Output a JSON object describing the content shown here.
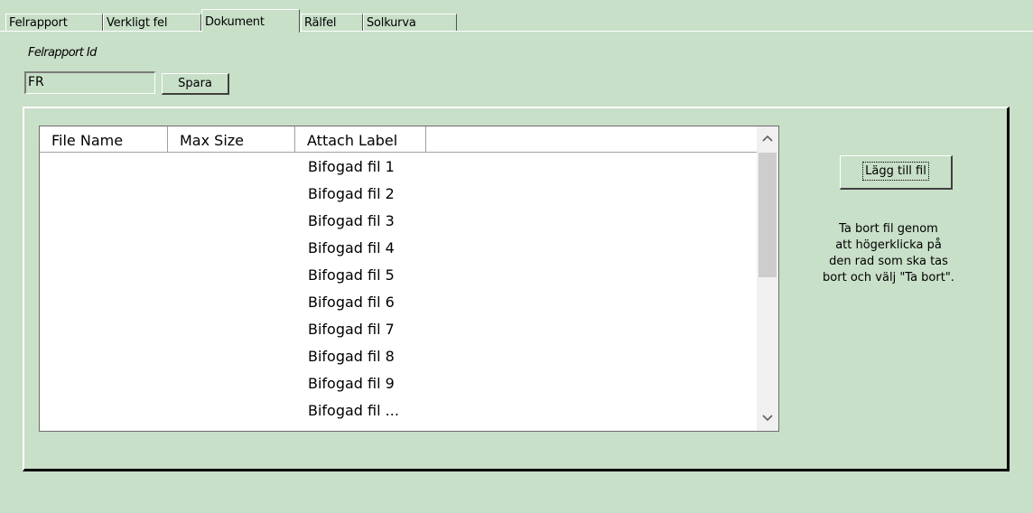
{
  "tabs": [
    {
      "label": "Felrapport",
      "active": false
    },
    {
      "label": "Verkligt fel",
      "active": false
    },
    {
      "label": "Dokument",
      "active": true
    },
    {
      "label": "Rälfel",
      "active": false
    },
    {
      "label": "Solkurva",
      "active": false
    }
  ],
  "felrapport": {
    "label": "Felrapport Id",
    "value": "FR",
    "save_label": "Spara"
  },
  "list": {
    "columns": [
      "File Name",
      "Max Size",
      "Attach Label"
    ],
    "rows": [
      {
        "file_name": "",
        "max_size": "",
        "attach_label": "Bifogad fil 1"
      },
      {
        "file_name": "",
        "max_size": "",
        "attach_label": "Bifogad fil 2"
      },
      {
        "file_name": "",
        "max_size": "",
        "attach_label": "Bifogad fil 3"
      },
      {
        "file_name": "",
        "max_size": "",
        "attach_label": "Bifogad fil 4"
      },
      {
        "file_name": "",
        "max_size": "",
        "attach_label": "Bifogad fil 5"
      },
      {
        "file_name": "",
        "max_size": "",
        "attach_label": "Bifogad fil 6"
      },
      {
        "file_name": "",
        "max_size": "",
        "attach_label": "Bifogad fil 7"
      },
      {
        "file_name": "",
        "max_size": "",
        "attach_label": "Bifogad fil 8"
      },
      {
        "file_name": "",
        "max_size": "",
        "attach_label": "Bifogad fil 9"
      },
      {
        "file_name": "",
        "max_size": "",
        "attach_label": "Bifogad fil ..."
      }
    ],
    "scroll_up_icon": "chevron-up-icon",
    "scroll_down_icon": "chevron-down-icon"
  },
  "actions": {
    "add_file_label": "Lägg till fil",
    "help_lines": [
      "Ta bort fil genom",
      "att högerklicka på",
      "den rad som ska tas",
      "bort och välj \"Ta bort\"."
    ]
  },
  "colors": {
    "background": "#c8dfc8",
    "list_background": "#ffffff"
  }
}
